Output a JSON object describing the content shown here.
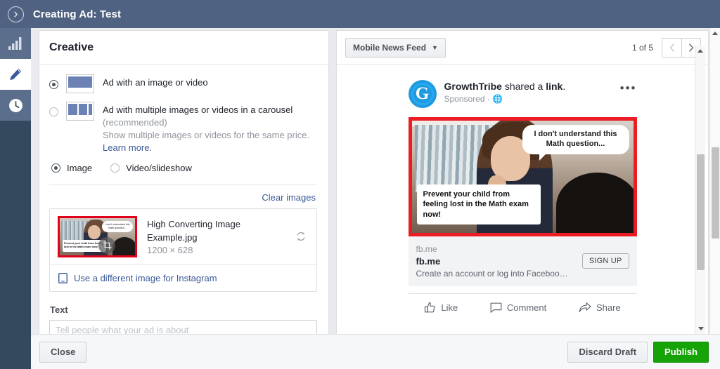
{
  "topbar": {
    "back_icon": "chevron-right-circle-icon",
    "title": "Creating Ad: Test"
  },
  "rail": {
    "items": [
      {
        "icon": "bar-chart-icon",
        "name": "campaign"
      },
      {
        "icon": "pencil-icon",
        "name": "ad-set"
      },
      {
        "icon": "clock-icon",
        "name": "history"
      }
    ]
  },
  "creative": {
    "heading": "Creative",
    "format_options": [
      {
        "title": "Ad with an image or video",
        "selected": true,
        "thumb": "single-image-icon"
      },
      {
        "title": "Ad with multiple images or videos in a carousel",
        "subtitle": "(recommended)",
        "description": "Show multiple images or videos for the same price.",
        "link": "Learn more.",
        "selected": false,
        "thumb": "carousel-icon"
      }
    ],
    "media_type": [
      {
        "label": "Image",
        "selected": true
      },
      {
        "label": "Video/slideshow",
        "selected": false
      }
    ],
    "clear_images": "Clear images",
    "image": {
      "filename": "High Converting Image Example.jpg",
      "dimensions": "1200 × 628",
      "refresh_icon": "refresh-icon",
      "crop_icon": "crop-icon",
      "bubble_text": "I don't understand this Math question...",
      "caption_text": "Prevent your child from feeling lost in the Math exam now!"
    },
    "instagram_row": {
      "icon": "mobile-device-icon",
      "label": "Use a different image for Instagram"
    },
    "text_label": "Text",
    "text_value": "",
    "text_placeholder": "Tell people what your ad is about"
  },
  "preview": {
    "placement": "Mobile News Feed",
    "placement_caret": "chevron-down-icon",
    "page_indicator": "1 of 5",
    "prev_icon": "chevron-left-icon",
    "next_icon": "chevron-right-icon",
    "post": {
      "avatar_letter": "G",
      "page_name": "GrowthTribe",
      "action_text": " shared a ",
      "action_link": "link",
      "action_period": ".",
      "sponsored": "Sponsored",
      "separator": "·",
      "globe_icon": "globe-icon",
      "menu_icon": "ellipsis-icon",
      "ad_image": {
        "bubble_text": "I don't understand this Math question...",
        "caption_text": "Prevent your child from feeling lost in the Math exam now!"
      },
      "link_card": {
        "domain": "fb.me",
        "title": "fb.me",
        "description": "Create an account or log into Faceboo…",
        "cta": "SIGN UP"
      },
      "actions": [
        {
          "label": "Like",
          "icon": "thumbs-up-icon"
        },
        {
          "label": "Comment",
          "icon": "speech-bubble-icon"
        },
        {
          "label": "Share",
          "icon": "share-arrow-icon"
        }
      ]
    }
  },
  "footer": {
    "close": "Close",
    "discard": "Discard Draft",
    "publish": "Publish"
  },
  "colors": {
    "topbar": "#4f6281",
    "rail": "#35495e",
    "accent_link": "#3b5998",
    "publish_green": "#16a308",
    "ad_border_red": "#ec1c24"
  }
}
